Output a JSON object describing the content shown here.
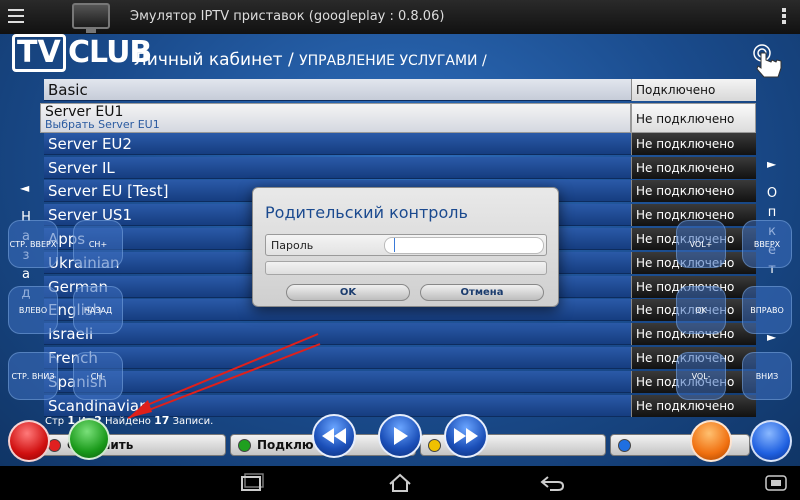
{
  "system": {
    "window_title": "Эмулятор IPTV приставок (googleplay : 0.8.06)"
  },
  "header": {
    "logo_left": "TV",
    "logo_right": "CLUB",
    "title_main": "Личный кабинет / ",
    "title_sub": "УПРАВЛЕНИЕ УСЛУГАМИ /"
  },
  "list": {
    "rows": [
      {
        "name": "Basic",
        "status": "Подключено"
      },
      {
        "name": "Server EU1",
        "sub": "Выбрать Server EU1",
        "status": "Не подключено"
      },
      {
        "name": "Server EU2",
        "status": "Не подключено"
      },
      {
        "name": "Server IL",
        "status": "Не подключено"
      },
      {
        "name": "Server EU [Test]",
        "status": "Не подключено"
      },
      {
        "name": "Server US1",
        "status": "Не подключено"
      },
      {
        "name": "Apps",
        "status": "Не подключено"
      },
      {
        "name": "Ukrainian",
        "status": "Не подключено"
      },
      {
        "name": "German",
        "status": "Не подключено"
      },
      {
        "name": "English",
        "status": "Не подключено"
      },
      {
        "name": "Israeli",
        "status": "Не подключено"
      },
      {
        "name": "French",
        "status": "Не подключено"
      },
      {
        "name": "Spanish",
        "status": "Не подключено"
      },
      {
        "name": "Scandinavian",
        "status": "Не подключено"
      }
    ]
  },
  "side": {
    "left_arrow": "◄",
    "left_text": [
      "Н",
      "а",
      "з",
      "а",
      "д"
    ],
    "right_arrow": "►",
    "right_text": [
      "О",
      "п",
      "к",
      "е",
      "т"
    ],
    "right_arrow2": "►"
  },
  "overlay_buttons": {
    "page_up": "СТР. ВВЕРХ",
    "ch_plus": "CH+",
    "left": "ВЛЕВО",
    "back": "НАЗАД",
    "page_down": "СТР. ВНИЗ",
    "ch_minus": "CH-",
    "vol_plus": "VOL+",
    "up": "ВВЕРХ",
    "ok": "OK",
    "right": "ВПРАВО",
    "vol_minus": "VOL-",
    "down": "ВНИЗ"
  },
  "dialog": {
    "title": "Родительский контроль",
    "password_label": "Пароль",
    "password_value": "",
    "ok_label": "OK",
    "cancel_label": "Отмена"
  },
  "footer": {
    "page_word": "Стр",
    "page_num": "1",
    "of_word": "Из",
    "page_total": "2",
    "found_word": "Найдено",
    "found_count": "17",
    "records_word": "Записи."
  },
  "bottom_bar": {
    "red_label": "Отменить",
    "green_label": "Подключить",
    "yellow_label": "",
    "blue_label": ""
  },
  "colors": {
    "red": "#e02020",
    "green": "#1fa01f",
    "yellow": "#f0c000",
    "blue": "#1f6fe0",
    "orange": "#f08010",
    "accent_blue": "#1a4b8c"
  },
  "icons": {
    "menu": "menu-icon",
    "tv": "tv-icon",
    "overflow": "overflow-menu-icon",
    "touch": "touch-hand-icon",
    "rewind": "rewind-icon",
    "play": "play-icon",
    "fast_forward": "fast-forward-icon",
    "back": "back-nav-icon",
    "home": "home-nav-icon",
    "recents": "recents-nav-icon"
  }
}
